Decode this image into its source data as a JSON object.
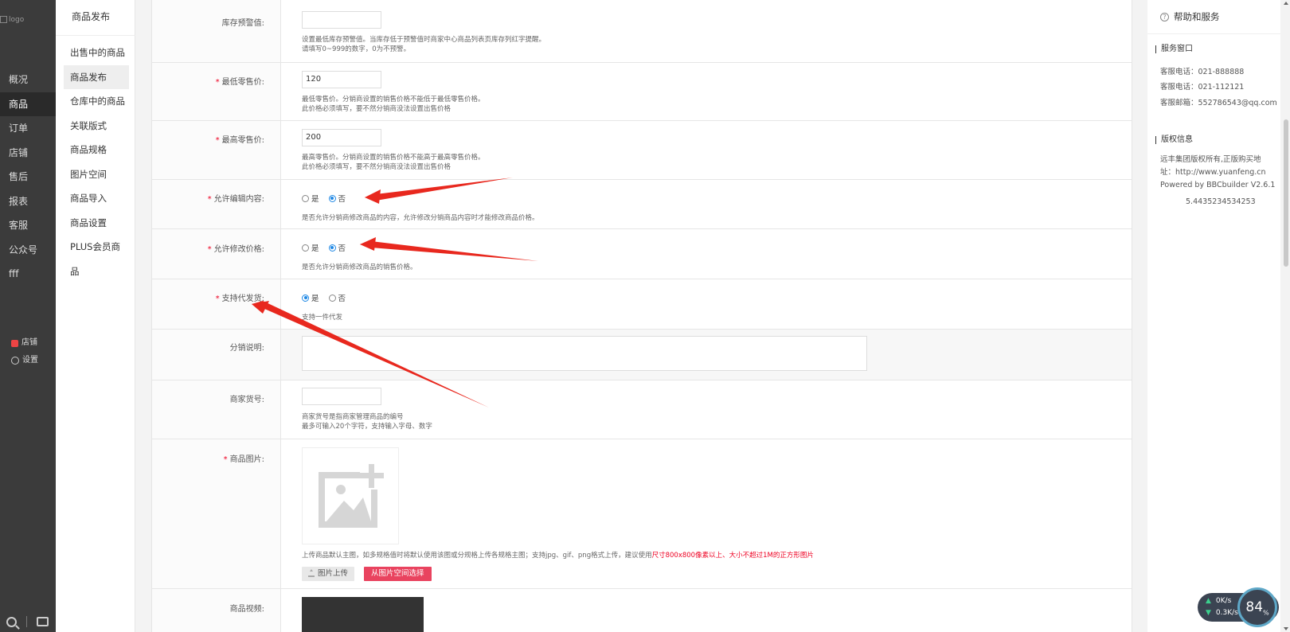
{
  "logo": {
    "alt": "logo"
  },
  "main_nav": [
    "概况",
    "商品",
    "订单",
    "店铺",
    "售后",
    "报表",
    "客服",
    "公众号",
    "fff"
  ],
  "nav_links": {
    "shop": "店铺",
    "settings": "设置"
  },
  "sub_nav": {
    "title": "商品发布",
    "items": [
      "出售中的商品",
      "商品发布",
      "仓库中的商品",
      "关联版式",
      "商品规格",
      "图片空间",
      "商品导入",
      "商品设置",
      "PLUS会员商品"
    ]
  },
  "form": {
    "stock_alert": {
      "label": "库存预警值:",
      "value": "",
      "hint1": "设置最低库存预警值。当库存低于预警值时商家中心商品列表页库存列红字提醒。",
      "hint2": "请填写0~999的数字，0为不预警。"
    },
    "min_price": {
      "label": "最低零售价:",
      "value": "120",
      "hint1": "最低零售价。分销商设置的销售价格不能低于最低零售价格。",
      "hint2": "此价格必须填写，要不然分销商没法设置出售价格"
    },
    "max_price": {
      "label": "最高零售价:",
      "value": "200",
      "hint1": "最高零售价。分销商设置的销售价格不能高于最高零售价格。",
      "hint2": "此价格必须填写，要不然分销商没法设置出售价格"
    },
    "allow_edit": {
      "label": "允许编辑内容:",
      "yes": "是",
      "no": "否",
      "hint": "是否允许分销商修改商品的内容，允许修改分销商品内容时才能修改商品价格。"
    },
    "allow_price": {
      "label": "允许修改价格:",
      "yes": "是",
      "no": "否",
      "hint": "是否允许分销商修改商品的销售价格。"
    },
    "dropship": {
      "label": "支持代发货:",
      "yes": "是",
      "no": "否",
      "hint": "支持一件代发"
    },
    "dist_desc": {
      "label": "分销说明:"
    },
    "merchant_sku": {
      "label": "商家货号:",
      "value": "",
      "hint1": "商家货号是指商家管理商品的编号",
      "hint2": "最多可输入20个字符，支持输入字母、数字"
    },
    "product_image": {
      "label": "商品图片:",
      "hint_prefix": "上传商品默认主图，如多规格值时将默认使用该图或分规格上传各规格主图；支持jpg、gif、png格式上传，建议使用",
      "hint_highlight": "尺寸800x800像素以上、大小不超过1M的正方形图片",
      "upload_btn": "图片上传",
      "pick_btn": "从图片空间选择"
    },
    "product_video": {
      "label": "商品视频:"
    }
  },
  "right_panel": {
    "title": "帮助和服务",
    "service_title": "服务窗口",
    "phone1": "客服电话：021-888888",
    "phone2": "客服电话：021-112121",
    "email": "客服邮箱：552786543@qq.com",
    "copyright_title": "版权信息",
    "copyright1": "远丰集团版权所有,正版购买地",
    "copyright2": "址：http://www.yuanfeng.cn",
    "copyright3": "Powered by BBCbuilder V2.6.1",
    "version": "5.4435234534253"
  },
  "net_widget": {
    "up": "0K/s",
    "down": "0.3K/s",
    "gauge": "84",
    "gauge_unit": "%"
  },
  "colors": {
    "accent": "#1e88e5",
    "required": "#ee0022",
    "pick_button": "#e9435f",
    "annotation_arrow": "#e8281e",
    "sidebar_bg": "#3b3b3b"
  }
}
